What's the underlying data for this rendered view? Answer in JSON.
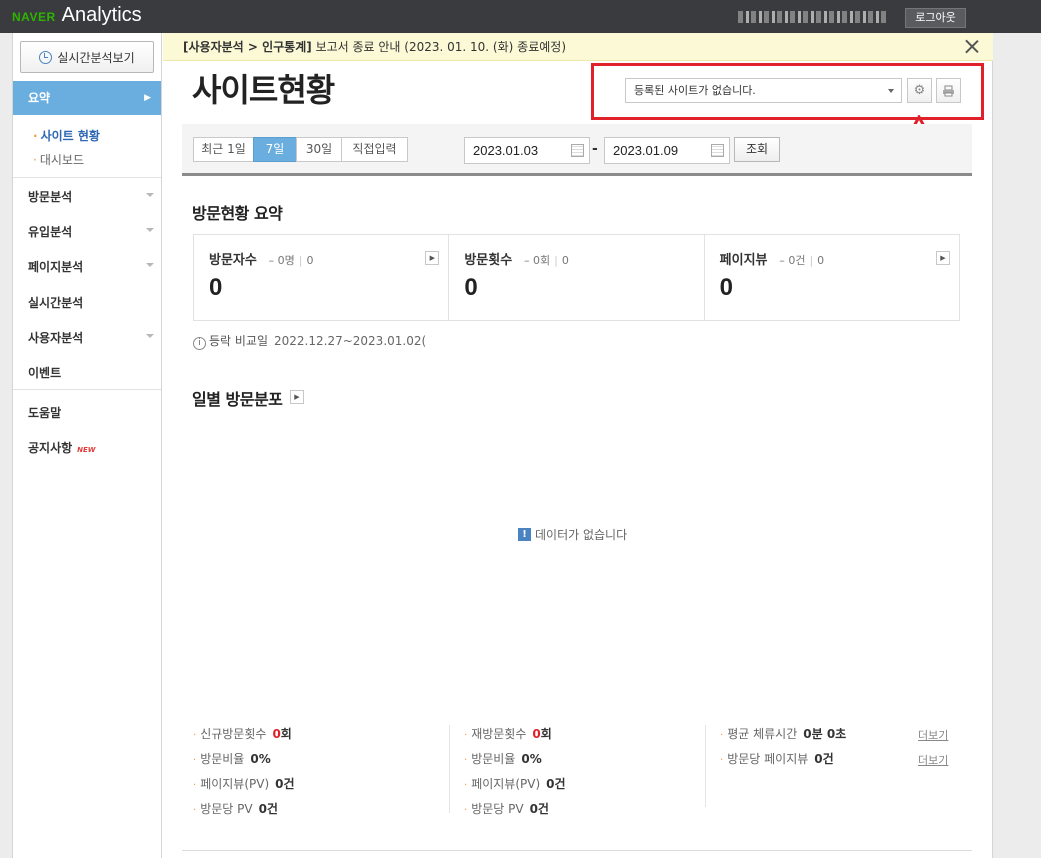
{
  "header": {
    "brand_naver": "NAVER",
    "brand_analytics": "Analytics",
    "logout_label": "로그아웃"
  },
  "sidebar": {
    "realtime_label": "실시간분석보기",
    "active_menu": "요약",
    "sub_items": [
      "사이트 현황",
      "대시보드"
    ],
    "menu": [
      "방문분석",
      "유입분석",
      "페이지분석",
      "실시간분석",
      "사용자분석",
      "이벤트",
      "도움말",
      "공지사항"
    ],
    "new_badge": "NEW"
  },
  "notice": {
    "emphasis": "[사용자분석 > 인구통계]",
    "text": " 보고서 종료 안내 (2023. 01. 10. (화) 종료예정)"
  },
  "page": {
    "title": "사이트현황",
    "site_select": "등록된 사이트가 없습니다."
  },
  "period": {
    "tabs": [
      "최근 1일",
      "7일",
      "30일",
      "직접입력"
    ],
    "active_tab": "7일",
    "start_date": "2023.01.03",
    "end_date": "2023.01.09",
    "dash": "-",
    "query_label": "조회"
  },
  "summary": {
    "title": "방문현황 요약",
    "cards": [
      {
        "title": "방문자수",
        "change": "0명",
        "change_pct": "0",
        "value": "0"
      },
      {
        "title": "방문횟수",
        "change": "0회",
        "change_pct": "0",
        "value": "0"
      },
      {
        "title": "페이지뷰",
        "change": "0건",
        "change_pct": "0",
        "value": "0"
      }
    ],
    "compare_label": "등락 비교일",
    "compare_dates": "2022.12.27~2023.01.02("
  },
  "daily": {
    "title": "일별 방문분포",
    "no_data": "데이터가 없습니다"
  },
  "stats": {
    "col1": [
      {
        "label": "신규방문횟수",
        "value": "0",
        "unit": "회",
        "highlight": true
      },
      {
        "label": "방문비율",
        "value": "0%",
        "unit": "",
        "highlight": false
      },
      {
        "label": "페이지뷰(PV)",
        "value": "0건",
        "unit": "",
        "highlight": false
      },
      {
        "label": "방문당 PV",
        "value": "0건",
        "unit": "",
        "highlight": false
      }
    ],
    "col2": [
      {
        "label": "재방문횟수",
        "value": "0",
        "unit": "회",
        "highlight": true
      },
      {
        "label": "방문비율",
        "value": "0%",
        "unit": "",
        "highlight": false
      },
      {
        "label": "페이지뷰(PV)",
        "value": "0건",
        "unit": "",
        "highlight": false
      },
      {
        "label": "방문당 PV",
        "value": "0건",
        "unit": "",
        "highlight": false
      }
    ],
    "col3": [
      {
        "label": "평균 체류시간",
        "value": "0분 0초"
      },
      {
        "label": "방문당 페이지뷰",
        "value": "0건"
      }
    ],
    "more_label": "더보기"
  },
  "colors": {
    "accent": "#6aaee0",
    "highlight_red": "#e1212a",
    "brand_green": "#2db400"
  }
}
